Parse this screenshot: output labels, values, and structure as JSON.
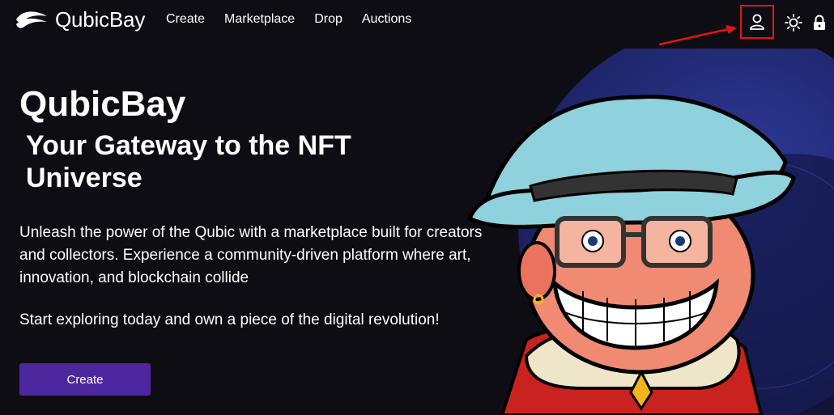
{
  "brand": {
    "name": "QubicBay"
  },
  "nav": {
    "items": [
      "Create",
      "Marketplace",
      "Drop",
      "Auctions"
    ]
  },
  "header_icons": [
    "user-icon",
    "sun-icon",
    "lock-icon"
  ],
  "hero": {
    "title": "QubicBay",
    "subtitle": "Your Gateway to the NFT Universe",
    "description": "Unleash the power of the Qubic with a marketplace built for creators and collectors. Experience a community-driven platform where art, innovation, and blockchain collide",
    "cta_text": "Start exploring today and own a piece of the digital revolution!",
    "button_label": "Create"
  },
  "colors": {
    "background": "#0f0d14",
    "button": "#4d279e",
    "highlight": "#e01616",
    "hat": "#8fd1dc",
    "circle": "#232d7a"
  }
}
